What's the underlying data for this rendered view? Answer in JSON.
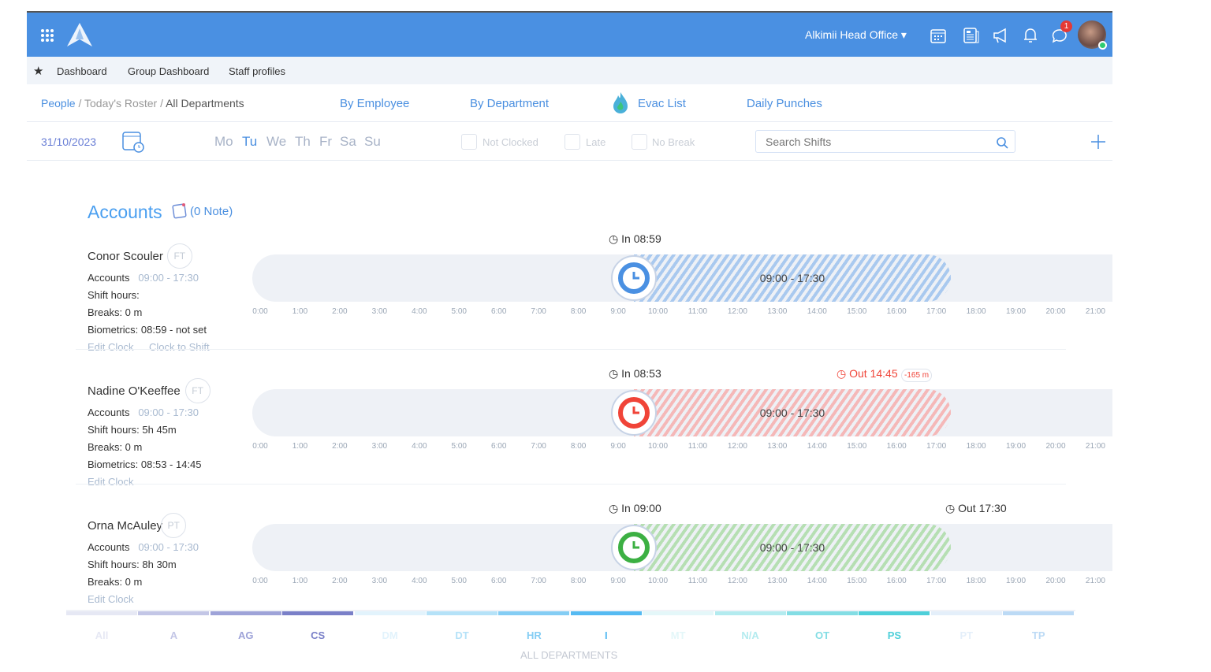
{
  "topbar": {
    "office": "Alkimii Head Office",
    "notification_count": "1",
    "icons": [
      "grid-icon",
      "logo",
      "calendar-icon",
      "newspaper-icon",
      "megaphone-icon",
      "bell-icon",
      "chat-icon",
      "avatar"
    ]
  },
  "nav": {
    "items": [
      "Dashboard",
      "Group Dashboard",
      "Staff profiles"
    ]
  },
  "breadcrumb": {
    "people": "People",
    "roster": "Today's Roster",
    "current": "All Departments",
    "sep": "/"
  },
  "views": {
    "by_employee": "By Employee",
    "by_department": "By Department",
    "evac": "Evac List",
    "punches": "Daily Punches"
  },
  "filters": {
    "date": "31/10/2023",
    "days": [
      "Mo",
      "Tu",
      "We",
      "Th",
      "Fr",
      "Sa",
      "Su"
    ],
    "selected_day": "Tu",
    "not_clocked": "Not Clocked",
    "late": "Late",
    "no_break": "No Break",
    "search_placeholder": "Search Shifts"
  },
  "section": {
    "title": "Accounts",
    "note": "(0 Note)"
  },
  "hours": [
    "0:00",
    "1:00",
    "2:00",
    "3:00",
    "4:00",
    "5:00",
    "6:00",
    "7:00",
    "8:00",
    "9:00",
    "10:00",
    "11:00",
    "12:00",
    "13:00",
    "14:00",
    "15:00",
    "16:00",
    "17:00",
    "18:00",
    "19:00",
    "20:00",
    "21:00"
  ],
  "employees": [
    {
      "name": "Conor Scouler",
      "type": "FT",
      "dept": "Accounts",
      "shift": "09:00 - 17:30",
      "shift_hours": "Shift hours:",
      "breaks": "Breaks: 0 m",
      "biometrics": "Biometrics: 08:59 - not set",
      "edit": "Edit Clock",
      "clock_to_shift": "Clock to Shift",
      "in": "In 08:59",
      "out": "",
      "out_diff": "",
      "color": "#4a90e2",
      "hatch": "#a9c9ef"
    },
    {
      "name": "Nadine O'Keeffee",
      "type": "FT",
      "dept": "Accounts",
      "shift": "09:00 - 17:30",
      "shift_hours": "Shift hours: 5h 45m",
      "breaks": "Breaks: 0 m",
      "biometrics": "Biometrics: 08:53 - 14:45",
      "edit": "Edit Clock",
      "clock_to_shift": "",
      "in": "In 08:53",
      "out": "Out 14:45",
      "out_diff": "-165 m",
      "color": "#f04438",
      "hatch": "#f5b8b8"
    },
    {
      "name": "Orna McAuley",
      "type": "PT",
      "dept": "Accounts",
      "shift": "09:00 - 17:30",
      "shift_hours": "Shift hours: 8h 30m",
      "breaks": "Breaks: 0 m",
      "biometrics": "",
      "edit": "Edit Clock",
      "clock_to_shift": "",
      "in": "In 09:00",
      "out": "Out 17:30",
      "out_diff": "",
      "color": "#3cb043",
      "hatch": "#b6dfb3"
    }
  ],
  "departments": {
    "footer": "ALL DEPARTMENTS",
    "items": [
      {
        "code": "All",
        "color": "#e6e8f4"
      },
      {
        "code": "A",
        "color": "#c3c6e6"
      },
      {
        "code": "AG",
        "color": "#9ea3d8"
      },
      {
        "code": "CS",
        "color": "#7a80c8"
      },
      {
        "code": "DM",
        "color": "#e2f3fc"
      },
      {
        "code": "DT",
        "color": "#b5e2f8"
      },
      {
        "code": "HR",
        "color": "#84cdf4"
      },
      {
        "code": "I",
        "color": "#55baf2"
      },
      {
        "code": "MT",
        "color": "#e4f7f9"
      },
      {
        "code": "N/A",
        "color": "#b3ebef"
      },
      {
        "code": "OT",
        "color": "#83dde4"
      },
      {
        "code": "PS",
        "color": "#4ecfd9"
      },
      {
        "code": "PT",
        "color": "#e4effa"
      },
      {
        "code": "TP",
        "color": "#bcdaf5"
      }
    ]
  }
}
